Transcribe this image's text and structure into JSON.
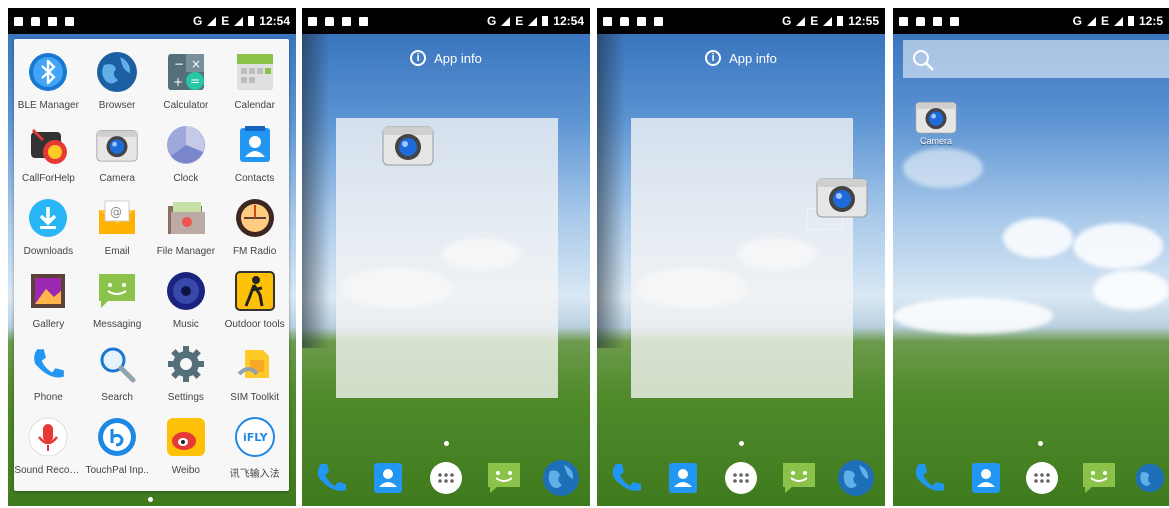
{
  "status_bar": {
    "network": "G",
    "network2": "E",
    "times": [
      "12:54",
      "12:54",
      "12:55",
      "12:5"
    ]
  },
  "app_drawer": {
    "apps": [
      {
        "label": "BLE Manager",
        "icon": "bluetooth-icon"
      },
      {
        "label": "Browser",
        "icon": "globe-icon"
      },
      {
        "label": "Calculator",
        "icon": "calculator-icon"
      },
      {
        "label": "Calendar",
        "icon": "calendar-icon"
      },
      {
        "label": "CallForHelp",
        "icon": "alarm-icon"
      },
      {
        "label": "Camera",
        "icon": "camera-icon"
      },
      {
        "label": "Clock",
        "icon": "clock-icon"
      },
      {
        "label": "Contacts",
        "icon": "contacts-icon"
      },
      {
        "label": "Downloads",
        "icon": "download-icon"
      },
      {
        "label": "Email",
        "icon": "email-icon"
      },
      {
        "label": "File Manager",
        "icon": "folder-icon"
      },
      {
        "label": "FM Radio",
        "icon": "radio-icon"
      },
      {
        "label": "Gallery",
        "icon": "gallery-icon"
      },
      {
        "label": "Messaging",
        "icon": "messaging-icon"
      },
      {
        "label": "Music",
        "icon": "music-icon"
      },
      {
        "label": "Outdoor tools",
        "icon": "hiker-icon"
      },
      {
        "label": "Phone",
        "icon": "phone-icon"
      },
      {
        "label": "Search",
        "icon": "search-icon"
      },
      {
        "label": "Settings",
        "icon": "gear-icon"
      },
      {
        "label": "SIM Toolkit",
        "icon": "sim-icon"
      },
      {
        "label": "Sound Record..",
        "icon": "microphone-icon"
      },
      {
        "label": "TouchPal Inp..",
        "icon": "touchpal-icon"
      },
      {
        "label": "Weibo",
        "icon": "weibo-icon"
      },
      {
        "label": "讯飞输入法",
        "icon": "ifly-icon"
      }
    ]
  },
  "app_info": {
    "label": "App info",
    "glyph": "i"
  },
  "ifly_text": "iFLY",
  "desktop": {
    "camera_label": "Camera"
  },
  "dock": [
    "phone-icon",
    "contacts-icon",
    "all-apps-icon",
    "messaging-icon",
    "browser-icon"
  ],
  "colors": {
    "status_bar": "#000000",
    "drawer_bg": "#f7f7f7",
    "accent_blue": "#1e88e5"
  }
}
